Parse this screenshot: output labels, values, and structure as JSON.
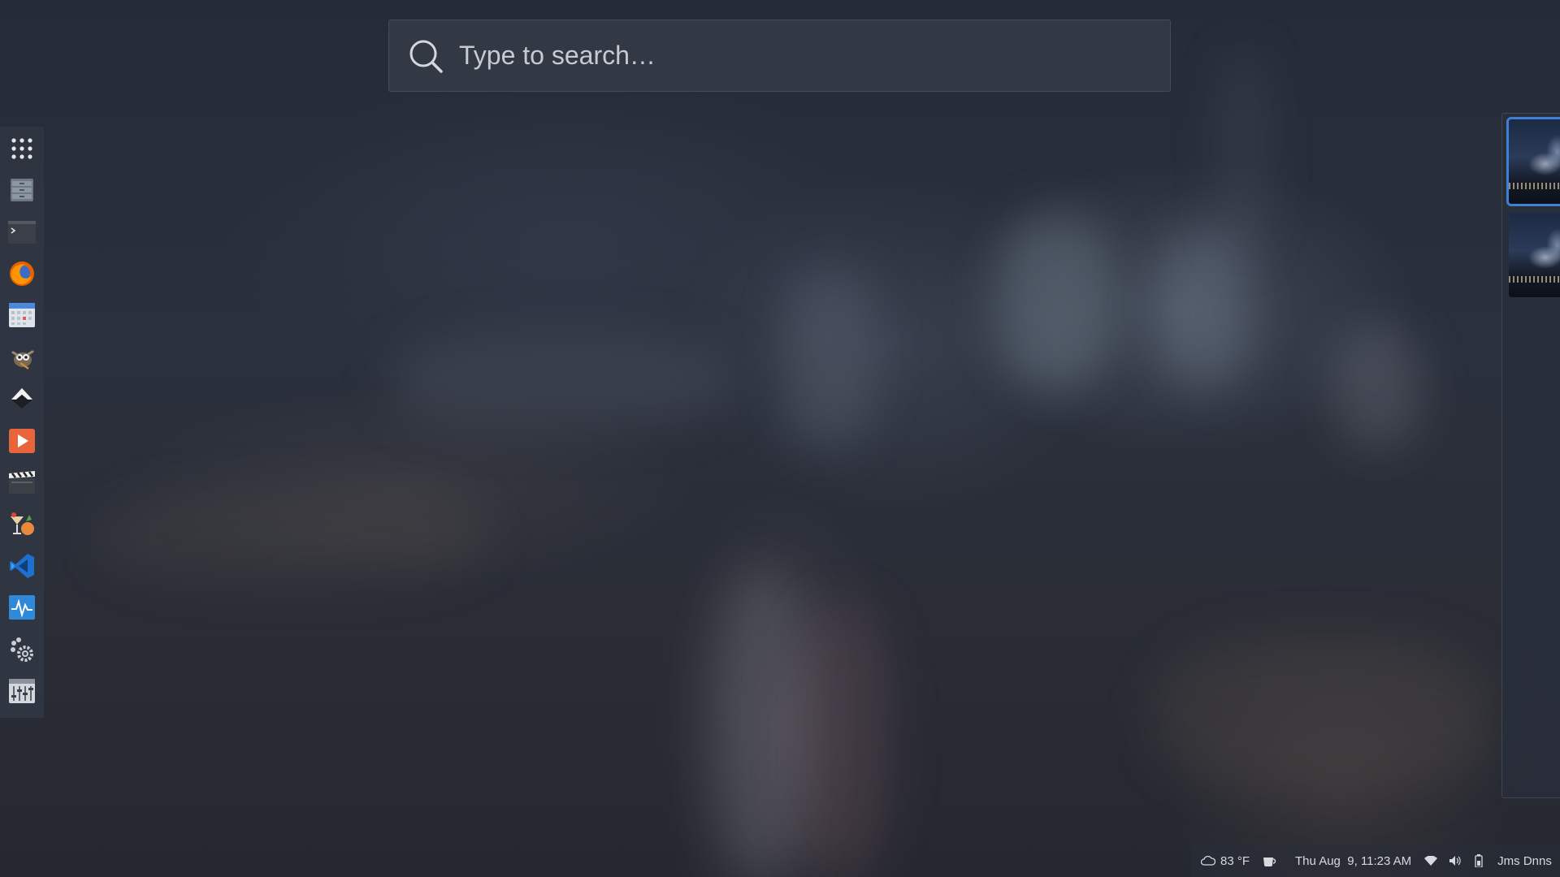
{
  "search": {
    "placeholder": "Type to search…",
    "icon": "search-icon"
  },
  "dock": {
    "items": [
      {
        "name": "app-grid",
        "icon": "app-grid-icon"
      },
      {
        "name": "file-manager",
        "icon": "file-cabinet-icon"
      },
      {
        "name": "terminal",
        "icon": "terminal-icon"
      },
      {
        "name": "firefox",
        "icon": "firefox-icon"
      },
      {
        "name": "calendar",
        "icon": "calendar-icon"
      },
      {
        "name": "gimp",
        "icon": "gimp-icon"
      },
      {
        "name": "inkscape",
        "icon": "inkscape-icon"
      },
      {
        "name": "media-player",
        "icon": "play-icon"
      },
      {
        "name": "video-editor",
        "icon": "clapperboard-icon"
      },
      {
        "name": "wine-app",
        "icon": "cocktail-icon"
      },
      {
        "name": "code-editor",
        "icon": "code-icon"
      },
      {
        "name": "system-monitor",
        "icon": "monitor-wave-icon"
      },
      {
        "name": "settings",
        "icon": "gear-paw-icon"
      },
      {
        "name": "mixer",
        "icon": "mixer-icon"
      }
    ]
  },
  "workspaces": {
    "items": [
      {
        "active": true
      },
      {
        "active": false
      }
    ]
  },
  "statusbar": {
    "weather": "83 °F",
    "datetime": "Thu Aug  9, 11:23 AM",
    "user": "Jms Dnns",
    "icons": [
      "cloud-icon",
      "coffee-icon",
      "wifi-icon",
      "volume-icon",
      "battery-icon"
    ]
  },
  "colors": {
    "accent": "#3f7fd6",
    "firefox": "#e66000",
    "vscode": "#2c7ad6"
  }
}
